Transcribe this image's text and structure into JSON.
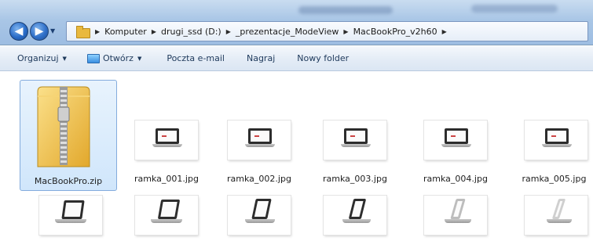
{
  "window": {
    "breadcrumb": [
      "Komputer",
      "drugi_ssd (D:)",
      "_prezentacje_ModeView",
      "MacBookPro_v2h60"
    ]
  },
  "toolbar": {
    "organize_label": "Organizuj",
    "open_label": "Otwórz",
    "email_label": "Poczta e-mail",
    "burn_label": "Nagraj",
    "new_folder_label": "Nowy folder"
  },
  "files": {
    "row1": [
      {
        "name": "MacBookPro.zip",
        "icon": "zip-folder-icon",
        "selected": true
      },
      {
        "name": "ramka_001.jpg",
        "icon": "image-thumbnail"
      },
      {
        "name": "ramka_002.jpg",
        "icon": "image-thumbnail"
      },
      {
        "name": "ramka_003.jpg",
        "icon": "image-thumbnail"
      },
      {
        "name": "ramka_004.jpg",
        "icon": "image-thumbnail"
      },
      {
        "name": "ramka_005.jpg",
        "icon": "image-thumbnail"
      }
    ],
    "row2_count_visible": 6
  },
  "colors": {
    "selection": "#cce4fb",
    "folder": "#e9b93e",
    "accent": "#2a6cc8"
  }
}
